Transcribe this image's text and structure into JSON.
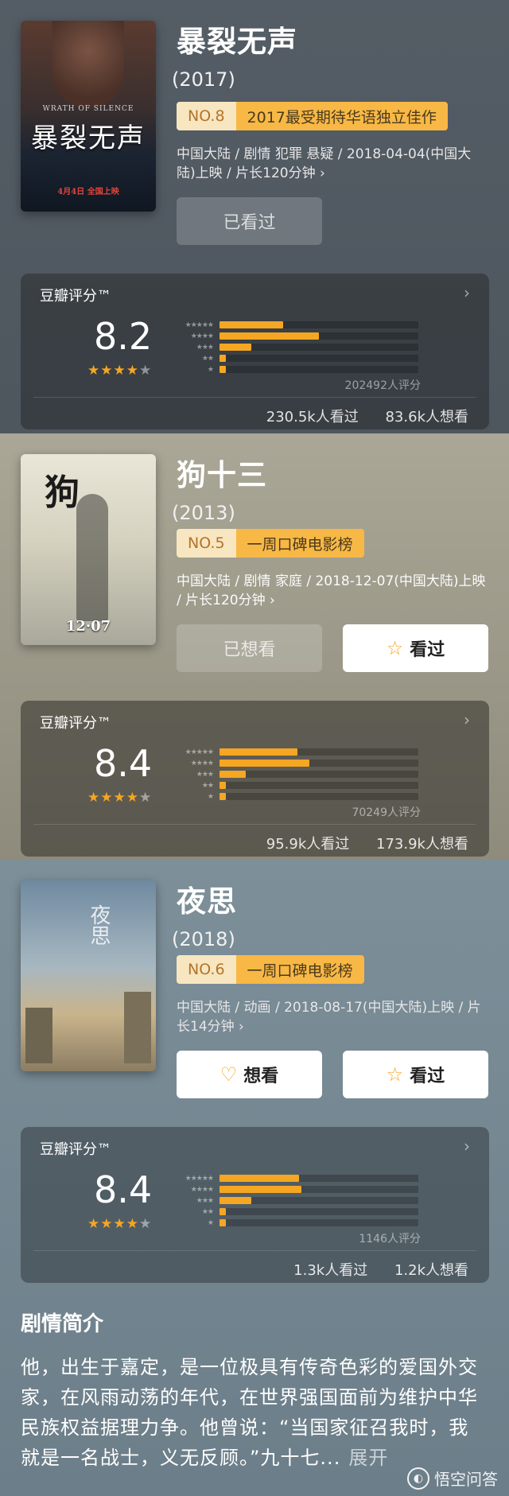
{
  "rating_label": "豆瓣评分™",
  "movies": [
    {
      "title": "暴裂无声",
      "year": "(2017)",
      "poster": {
        "en": "WRATH OF SILENCE",
        "title": "暴裂无声",
        "date": "4月4日 全国上映"
      },
      "rank_no": "NO.8",
      "rank_list": "2017最受期待华语独立佳作",
      "meta": "中国大陆 / 剧情 犯罪 悬疑 / 2018-04-04(中国大陆)上映 / 片长120分钟 ›",
      "buttons": [
        {
          "label": "已看过",
          "style": "disabled"
        }
      ],
      "rating": {
        "score": "8.2",
        "stars": 4,
        "count": "202492人评分",
        "seen": "230.5k人看过",
        "want": "83.6k人想看",
        "distribution": [
          0.32,
          0.5,
          0.16,
          0.03,
          0.02
        ]
      }
    },
    {
      "title": "狗十三",
      "year": "(2013)",
      "poster": {
        "title": "狗",
        "date": "12·07"
      },
      "rank_no": "NO.5",
      "rank_list": "一周口碑电影榜",
      "meta": "中国大陆 / 剧情 家庭 / 2018-12-07(中国大陆)上映 / 片长120分钟 ›",
      "buttons": [
        {
          "label": "已想看",
          "style": "disabled"
        },
        {
          "label": "看过",
          "style": "white",
          "icon": "star-outline-icon"
        }
      ],
      "rating": {
        "score": "8.4",
        "stars": 4,
        "count": "70249人评分",
        "seen": "95.9k人看过",
        "want": "173.9k人想看",
        "distribution": [
          0.39,
          0.45,
          0.13,
          0.03,
          0.02
        ]
      }
    },
    {
      "title": "夜思",
      "year": "(2018)",
      "poster": {
        "title": "夜思"
      },
      "rank_no": "NO.6",
      "rank_list": "一周口碑电影榜",
      "meta": "中国大陆 / 动画 / 2018-08-17(中国大陆)上映 / 片长14分钟 ›",
      "buttons": [
        {
          "label": "想看",
          "style": "white",
          "icon": "heart-plus-icon"
        },
        {
          "label": "看过",
          "style": "white",
          "icon": "star-outline-icon"
        }
      ],
      "rating": {
        "score": "8.4",
        "stars": 4,
        "count": "1146人评分",
        "seen": "1.3k人看过",
        "want": "1.2k人想看",
        "distribution": [
          0.4,
          0.41,
          0.16,
          0.02,
          0.0
        ]
      }
    }
  ],
  "synopsis": {
    "title": "剧情简介",
    "text": "他，出生于嘉定，是一位极具有传奇色彩的爱国外交家，在风雨动荡的年代，在世界强国面前为维护中华民族权益据理力争。他曾说：“当国家征召我时，我就是一名战士，义无反顾。”九十七...",
    "expand": "展开"
  },
  "watermark": "悟空问答",
  "colors": {
    "accent": "#f5a623",
    "rank_bg": "#f8b845"
  }
}
